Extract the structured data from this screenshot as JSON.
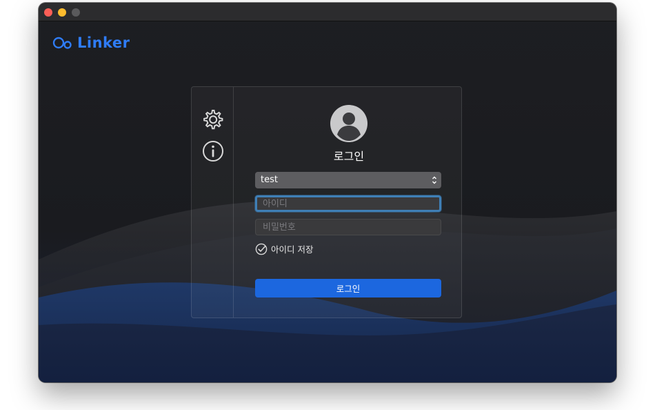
{
  "app": {
    "logo_text": "Linker"
  },
  "sidebar": {
    "settings_icon": "gear-icon",
    "info_icon": "info-icon"
  },
  "login": {
    "title": "로그인",
    "server_select": {
      "selected": "test"
    },
    "id_field": {
      "value": "",
      "placeholder": "아이디"
    },
    "password_field": {
      "value": "",
      "placeholder": "비밀번호"
    },
    "save_id": {
      "label": "아이디 저장",
      "checked": true
    },
    "submit_label": "로그인"
  },
  "colors": {
    "accent": "#1c67df",
    "logo": "#2f7cf6",
    "focus_ring": "#3f7fb6"
  }
}
